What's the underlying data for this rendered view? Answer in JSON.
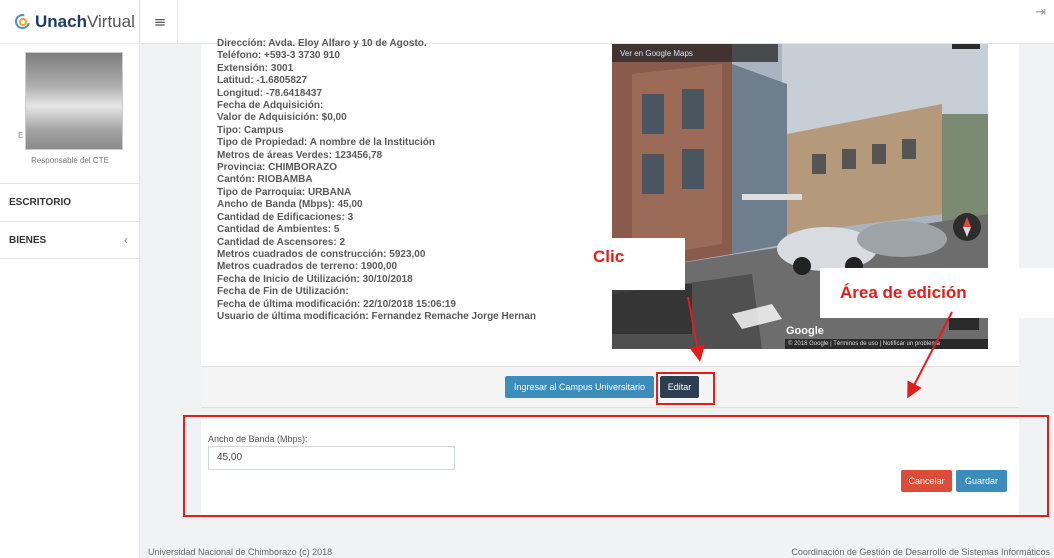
{
  "brand": {
    "bold": "Unach",
    "light": "Virtual"
  },
  "user": {
    "initial": "E",
    "role": "Responsable del CTE"
  },
  "nav": {
    "items": [
      {
        "label": "ESCRITORIO"
      },
      {
        "label": "BIENES"
      }
    ]
  },
  "topbar": {
    "menu_glyph": "≡",
    "logout_glyph": "⇥"
  },
  "info_lines": [
    "Dirección: Avda. Eloy Alfaro y 10 de Agosto.",
    "Teléfono: +593-3 3730 910",
    "Extensión: 3001",
    "Latitud: -1.6805827",
    "Longitud: -78.6418437",
    "Fecha de Adquisición:",
    "Valor de Adquisición: $0,00",
    "Tipo: Campus",
    "Tipo de Propiedad: A nombre de la Institución",
    "Metros de áreas Verdes: 123456,78",
    "Provincia: CHIMBORAZO",
    "Cantón: RIOBAMBA",
    "Tipo de Parroquia: URBANA",
    "Ancho de Banda (Mbps): 45,00",
    "Cantidad de Edificaciones: 3",
    "Cantidad de Ambientes: 5",
    "Cantidad de Ascensores: 2",
    "Metros cuadrados de construcción: 5923,00",
    "Metros cuadrados de terreno: 1900,00",
    "Fecha de Inicio de Utilización: 30/10/2018",
    "Fecha de Fin de Utilización:",
    "Fecha de última modificación: 22/10/2018 15:06:19",
    "Usuario de última modificación: Fernandez Remache Jorge Hernan"
  ],
  "map": {
    "link": "Ver en Google Maps",
    "logo": "Google",
    "footer": "© 2018 Google | Términos de uso | Notificar un problema"
  },
  "actions": {
    "campus": "Ingresar al Campus Universitario",
    "edit": "Editar"
  },
  "edit_form": {
    "label": "Ancho de Banda (Mbps):",
    "value": "45,00",
    "cancel": "Cancelar",
    "save": "Guardar"
  },
  "annotations": {
    "click": "Clic",
    "area": "Área de edición",
    "color": "#e41c1c"
  },
  "footer": {
    "left": "Universidad Nacional de Chimborazo (c) 2018",
    "right": "Coordinación de Gestión de Desarrollo de Sistemas Informáticos"
  },
  "colors": {
    "primary": "#3c8dbc",
    "dark": "#2c3e50",
    "danger": "#dd4b39"
  }
}
